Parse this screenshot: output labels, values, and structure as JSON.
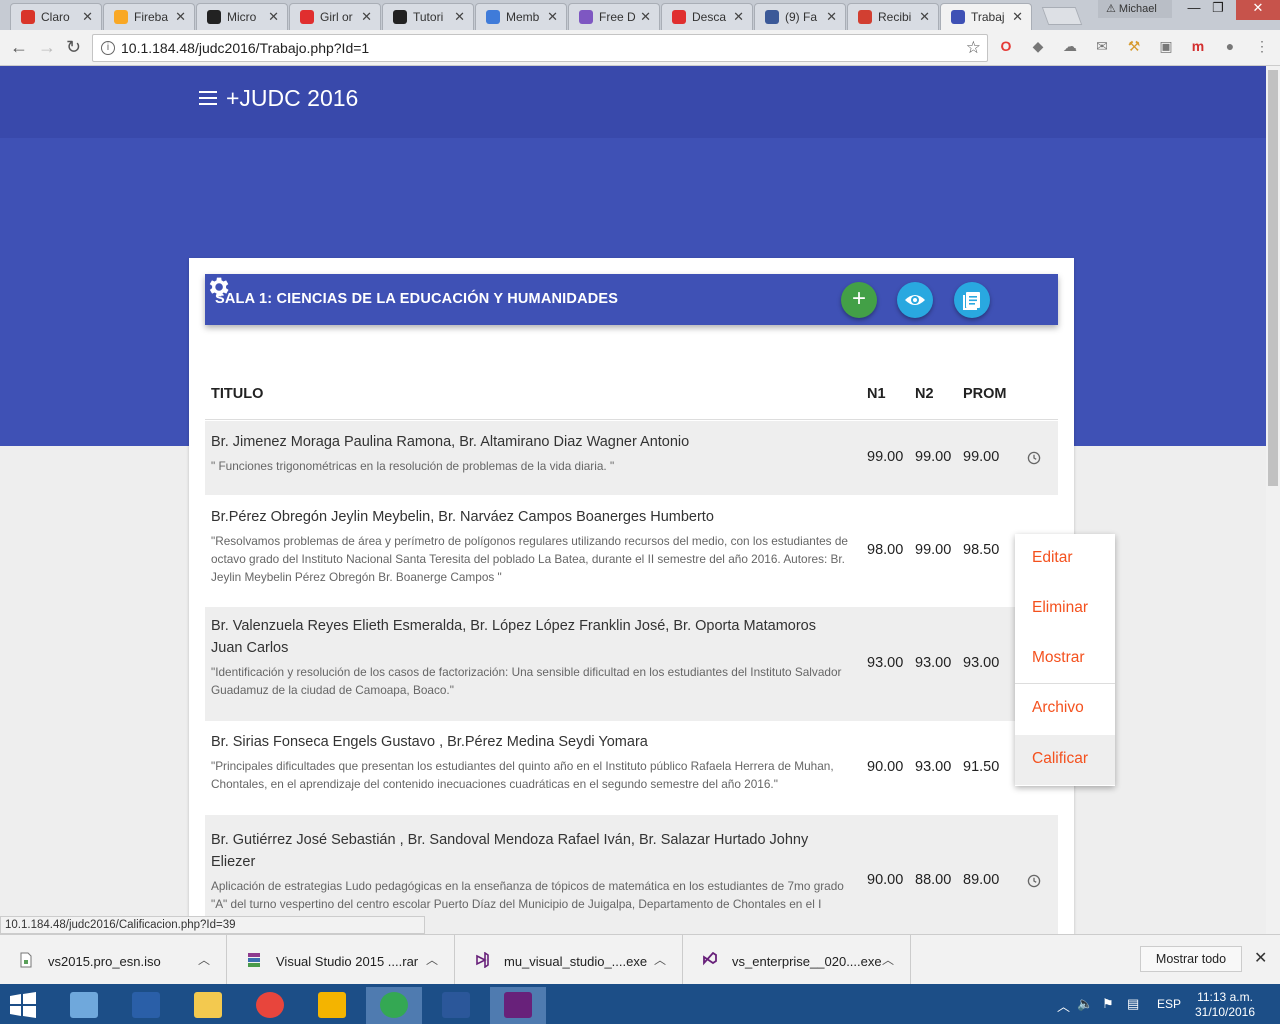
{
  "browser": {
    "tabs": [
      {
        "label": "Claro",
        "color": "#d9352a"
      },
      {
        "label": "Fireba",
        "color": "#f9a825"
      },
      {
        "label": "Micro",
        "color": "#222222"
      },
      {
        "label": "Girl or",
        "color": "#e02f2f"
      },
      {
        "label": "Tutori",
        "color": "#222222"
      },
      {
        "label": "Memb",
        "color": "#3f7bd9"
      },
      {
        "label": "Free D",
        "color": "#7e57c2"
      },
      {
        "label": "Desca",
        "color": "#e02f2f"
      },
      {
        "label": "(9) Fa",
        "color": "#3b5998"
      },
      {
        "label": "Recibi",
        "color": "#d23f31"
      },
      {
        "label": "Trabaj",
        "color": "#3f51b5",
        "active": true
      }
    ],
    "profile_name": "Michael",
    "url": "10.1.184.48/judc2016/Trabajo.php?Id=1",
    "status_url": "10.1.184.48/judc2016/Calificacion.php?Id=39"
  },
  "app": {
    "title": "+JUDC 2016",
    "sala_title": "SALA 1: CIENCIAS DE LA EDUCACIÓN Y HUMANIDADES"
  },
  "table": {
    "headers": {
      "titulo": "TITULO",
      "n1": "N1",
      "n2": "N2",
      "prom": "PROM"
    },
    "rows": [
      {
        "authors": "Br. Jimenez Moraga Paulina Ramona, Br. Altamirano Diaz Wagner Antonio",
        "title": "\" Funciones trigonométricas en la resolución de problemas de la vida diaria. \"",
        "n1": "99.00",
        "n2": "99.00",
        "prom": "99.00"
      },
      {
        "authors": "Br.Pérez Obregón Jeylin Meybelin, Br. Narváez Campos Boanerges Humberto",
        "title": "\"Resolvamos problemas de área y perímetro de polígonos regulares utilizando recursos del medio, con los estudiantes de octavo grado del Instituto Nacional Santa Teresita del poblado La Batea, durante el II semestre del año 2016. Autores: Br. Jeylin Meybelin Pérez Obregón Br. Boanerge Campos \"",
        "n1": "98.00",
        "n2": "99.00",
        "prom": "98.50"
      },
      {
        "authors": "Br. Valenzuela Reyes Elieth Esmeralda, Br. López López Franklin José, Br. Oporta Matamoros Juan Carlos",
        "title": "\"Identificación y resolución de los casos de factorización: Una sensible dificultad en los estudiantes del Instituto Salvador Guadamuz de la ciudad de Camoapa, Boaco.\"",
        "n1": "93.00",
        "n2": "93.00",
        "prom": "93.00"
      },
      {
        "authors": "Br. Sirias Fonseca Engels Gustavo , Br.Pérez Medina Seydi Yomara",
        "title": "\"Principales dificultades que presentan los estudiantes del quinto año en el Instituto público Rafaela Herrera de Muhan, Chontales, en el aprendizaje del contenido inecuaciones cuadráticas en el segundo semestre del año 2016.\"",
        "n1": "90.00",
        "n2": "93.00",
        "prom": "91.50"
      },
      {
        "authors": "Br. Gutiérrez José Sebastián , Br. Sandoval Mendoza Rafael Iván, Br. Salazar Hurtado Johny Eliezer",
        "title": "Aplicación de estrategias Ludo pedagógicas en la enseñanza de tópicos de matemática en los estudiantes de 7mo grado \"A\" del turno vespertino del centro escolar Puerto Díaz del Municipio de Juigalpa, Departamento de Chontales en el I",
        "n1": "90.00",
        "n2": "88.00",
        "prom": "89.00"
      }
    ]
  },
  "dropdown": {
    "items": [
      "Editar",
      "Eliminar",
      "Mostrar",
      "Archivo",
      "Calificar"
    ]
  },
  "downloads": {
    "items": [
      {
        "name": "vs2015.pro_esn.iso"
      },
      {
        "name": "Visual Studio 2015 ....rar"
      },
      {
        "name": "mu_visual_studio_....exe"
      },
      {
        "name": "vs_enterprise__020....exe"
      }
    ],
    "show_all": "Mostrar todo"
  },
  "taskbar": {
    "lang": "ESP",
    "time": "11:13 a.m.",
    "date": "31/10/2016"
  },
  "colors": {
    "primary": "#3f51b5",
    "accent_green": "#43a047",
    "accent_blue": "#29a8e0",
    "menu_text": "#f4511e"
  }
}
